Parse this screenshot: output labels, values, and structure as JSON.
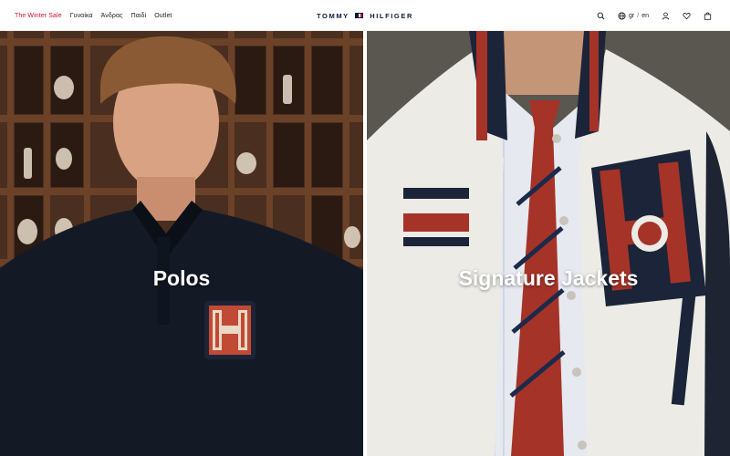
{
  "header": {
    "nav": [
      {
        "label": "The Winter Sale",
        "highlight": true
      },
      {
        "label": "Γυναίκα",
        "highlight": false
      },
      {
        "label": "Άνδρας",
        "highlight": false
      },
      {
        "label": "Παιδί",
        "highlight": false
      },
      {
        "label": "Outlet",
        "highlight": false
      }
    ],
    "logo": {
      "left": "TOMMY",
      "right": "HILFIGER"
    },
    "language": {
      "current": "gr",
      "separator": "/",
      "alternate": "en"
    },
    "icons": [
      "search-icon",
      "globe-icon",
      "account-icon",
      "wishlist-icon",
      "bag-icon"
    ]
  },
  "panels": [
    {
      "title": "Polos"
    },
    {
      "title": "Signature Jackets"
    }
  ],
  "colors": {
    "sale": "#cc1030",
    "brand_navy": "#0e1b3d",
    "brand_red": "#cc1030"
  }
}
